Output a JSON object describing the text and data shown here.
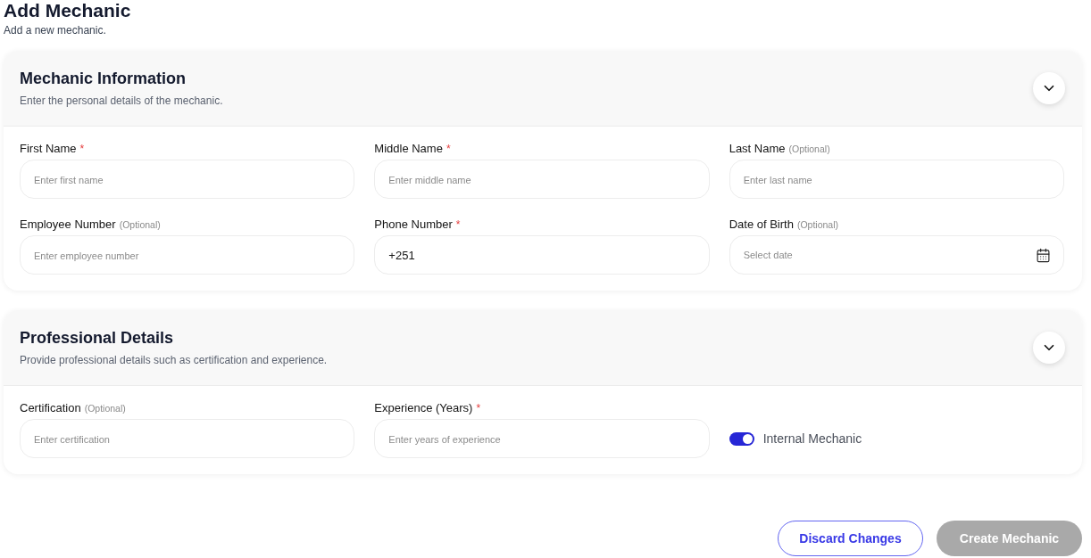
{
  "page": {
    "title": "Add Mechanic",
    "subtitle": "Add a new mechanic."
  },
  "sections": [
    {
      "title": "Mechanic Information",
      "subtitle": "Enter the personal details of the mechanic.",
      "expanded": true,
      "fields": [
        {
          "kind": "text",
          "label": "First Name",
          "tag": {
            "kind": "required",
            "text": "*"
          },
          "placeholder": "Enter first name"
        },
        {
          "kind": "text",
          "label": "Middle Name",
          "tag": {
            "kind": "required",
            "text": "*"
          },
          "placeholder": "Enter middle name"
        },
        {
          "kind": "text",
          "label": "Last Name",
          "tag": {
            "kind": "optional",
            "text": "(Optional)"
          },
          "placeholder": "Enter last name"
        },
        {
          "kind": "text",
          "label": "Employee Number",
          "tag": {
            "kind": "optional",
            "text": "(Optional)"
          },
          "placeholder": "Enter employee number"
        },
        {
          "kind": "text",
          "label": "Phone Number",
          "tag": {
            "kind": "required",
            "text": "*"
          },
          "value": "+251"
        },
        {
          "kind": "date",
          "label": "Date of Birth",
          "tag": {
            "kind": "optional",
            "text": "(Optional)"
          },
          "placeholder": "Select date"
        }
      ]
    },
    {
      "title": "Professional Details",
      "subtitle": "Provide professional details such as certification and experience.",
      "expanded": true,
      "fields": [
        {
          "kind": "text",
          "label": "Certification",
          "tag": {
            "kind": "optional",
            "text": "(Optional)"
          },
          "placeholder": "Enter certification"
        },
        {
          "kind": "text",
          "label": "Experience (Years)",
          "tag": {
            "kind": "required",
            "text": "*"
          },
          "placeholder": "Enter years of experience"
        },
        {
          "kind": "switch",
          "label": "Internal Mechanic",
          "on": true
        }
      ]
    }
  ],
  "actions": [
    {
      "kind": "outline",
      "label": "Discard Changes",
      "disabled": false
    },
    {
      "kind": "primary",
      "label": "Create Mechanic",
      "disabled": true
    }
  ]
}
